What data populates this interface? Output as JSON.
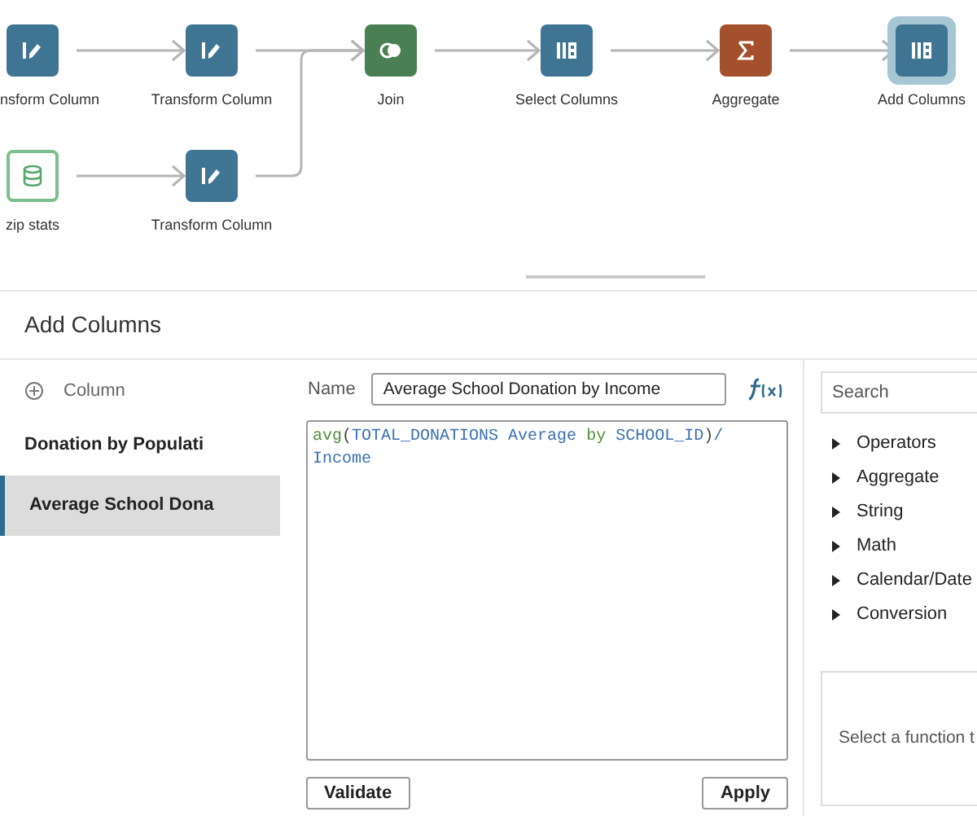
{
  "pipeline": {
    "nodes": [
      {
        "label": "nsform Column",
        "kind": "transform",
        "selected": false
      },
      {
        "label": "Transform Column",
        "kind": "transform",
        "selected": false
      },
      {
        "label": "Join",
        "kind": "join",
        "selected": false
      },
      {
        "label": "Select Columns",
        "kind": "select",
        "selected": false
      },
      {
        "label": "Aggregate",
        "kind": "aggregate",
        "selected": false
      },
      {
        "label": "Add Columns",
        "kind": "select",
        "selected": true
      },
      {
        "label": "zip stats",
        "kind": "dataset",
        "selected": false
      },
      {
        "label": "Transform Column",
        "kind": "transform",
        "selected": false
      }
    ]
  },
  "panel": {
    "title": "Add Columns",
    "add_column": "Column",
    "columns": [
      {
        "label": "Donation by Populati",
        "selected": false
      },
      {
        "label": "Average School Dona",
        "selected": true
      }
    ],
    "name_label": "Name",
    "name_value": "Average School Donation by Income",
    "expression": [
      {
        "text": "avg",
        "kind": "function"
      },
      {
        "text": "(",
        "kind": "punct"
      },
      {
        "text": "TOTAL_DONATIONS Average ",
        "kind": "field"
      },
      {
        "text": "by ",
        "kind": "keyword"
      },
      {
        "text": "SCHOOL_ID",
        "kind": "field"
      },
      {
        "text": ")",
        "kind": "punct"
      },
      {
        "text": "/",
        "kind": "operator"
      },
      {
        "text": "Income",
        "kind": "break_field"
      }
    ],
    "validate": "Validate",
    "apply": "Apply",
    "search": {
      "placeholder": "Search"
    },
    "categories": [
      "Operators",
      "Aggregate",
      "String",
      "Math",
      "Calendar/Date",
      "Conversion"
    ],
    "help": "Select a function t"
  }
}
